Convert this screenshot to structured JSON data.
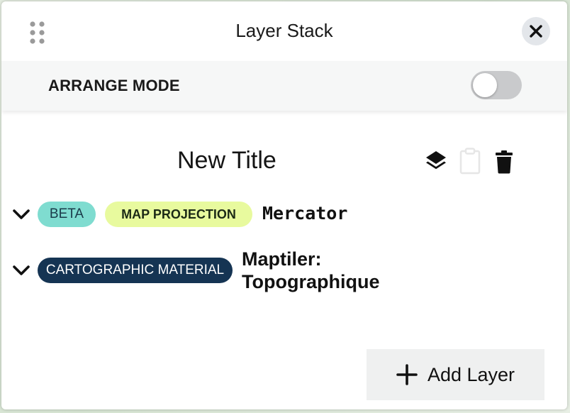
{
  "panel": {
    "title": "Layer Stack",
    "arrange_mode": {
      "label": "ARRANGE MODE",
      "enabled": false
    }
  },
  "stack": {
    "title": "New Title",
    "actions": [
      {
        "icon": "layers-icon"
      },
      {
        "icon": "clipboard-icon",
        "disabled": true
      },
      {
        "icon": "trash-icon"
      }
    ],
    "layers": [
      {
        "badges": [
          {
            "label": "BETA",
            "color": "#7fdcd0"
          },
          {
            "label": "MAP PROJECTION",
            "color": "#e8fa9e"
          }
        ],
        "name": "Mercator",
        "expanded": false
      },
      {
        "badges": [
          {
            "label": "CARTOGRAPHIC MATERIAL",
            "color": "#153453"
          }
        ],
        "name_line1": "Maptiler:",
        "name_line2": "Topographique",
        "expanded": false
      }
    ]
  },
  "footer": {
    "add_label": "Add Layer",
    "add_icon": "plus-icon"
  }
}
